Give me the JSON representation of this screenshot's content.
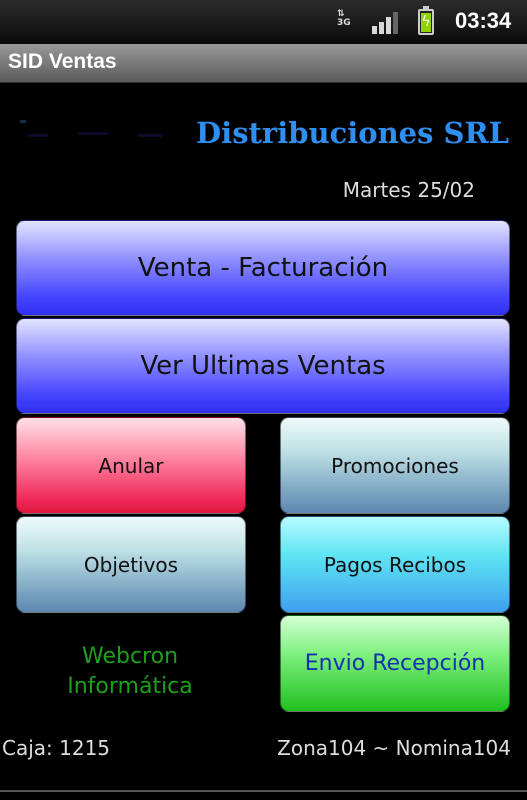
{
  "status_bar": {
    "network_type": "3G",
    "signal_icon": "signal-bars-icon",
    "battery_icon": "battery-charging-icon",
    "time": "03:34"
  },
  "app": {
    "title": "SID Ventas"
  },
  "header": {
    "company": "Distribuciones SRL",
    "date": "Martes 25/02"
  },
  "buttons": {
    "venta": "Venta - Facturación",
    "ultimas": "Ver Ultimas Ventas",
    "anular": "Anular",
    "promociones": "Promociones",
    "objetivos": "Objetivos",
    "pagos": "Pagos Recibos",
    "envio": "Envio Recepción"
  },
  "branding": {
    "line1": "Webcron",
    "line2": "Informática"
  },
  "footer": {
    "caja": "Caja: 1215",
    "zona": "Zona104 ~ Nomina104"
  },
  "colors": {
    "company_text": "#2f8ff0",
    "branding_text": "#1ea01e",
    "blue_button": "#4646ff",
    "red_button": "#f02a5a",
    "green_button": "#20c020",
    "cyan_button": "#5fe5f3"
  }
}
